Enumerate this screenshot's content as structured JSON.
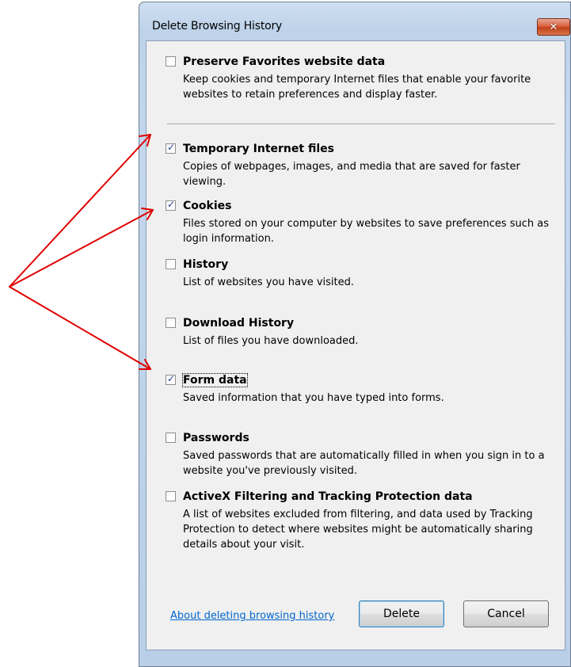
{
  "window": {
    "title": "Delete Browsing History",
    "close_glyph": "✕"
  },
  "options": [
    {
      "title": "Preserve Favorites website data",
      "checked": false,
      "description": "Keep cookies and temporary Internet files that enable your favorite websites to retain preferences and display faster."
    },
    {
      "title": "Temporary Internet files",
      "checked": true,
      "description": "Copies of webpages, images, and media that are saved for faster viewing."
    },
    {
      "title": "Cookies",
      "checked": true,
      "description": "Files stored on your computer by websites to save preferences such as login information."
    },
    {
      "title": "History",
      "checked": false,
      "description": "List of websites you have visited."
    },
    {
      "title": "Download History",
      "checked": false,
      "description": "List of files you have downloaded."
    },
    {
      "title": "Form data",
      "checked": true,
      "description": "Saved information that you have typed into forms."
    },
    {
      "title": "Passwords",
      "checked": false,
      "description": "Saved passwords that are automatically filled in when you sign in to a website you've previously visited."
    },
    {
      "title": "ActiveX Filtering and Tracking Protection data",
      "checked": false,
      "description": "A list of websites excluded from filtering, and data used by Tracking Protection to detect where websites might be automatically sharing details about your visit."
    }
  ],
  "footer": {
    "about_link": "About deleting browsing history",
    "delete_label": "Delete",
    "cancel_label": "Cancel"
  },
  "colors": {
    "annotation_arrow": "#e00000",
    "link": "#0066cc"
  }
}
